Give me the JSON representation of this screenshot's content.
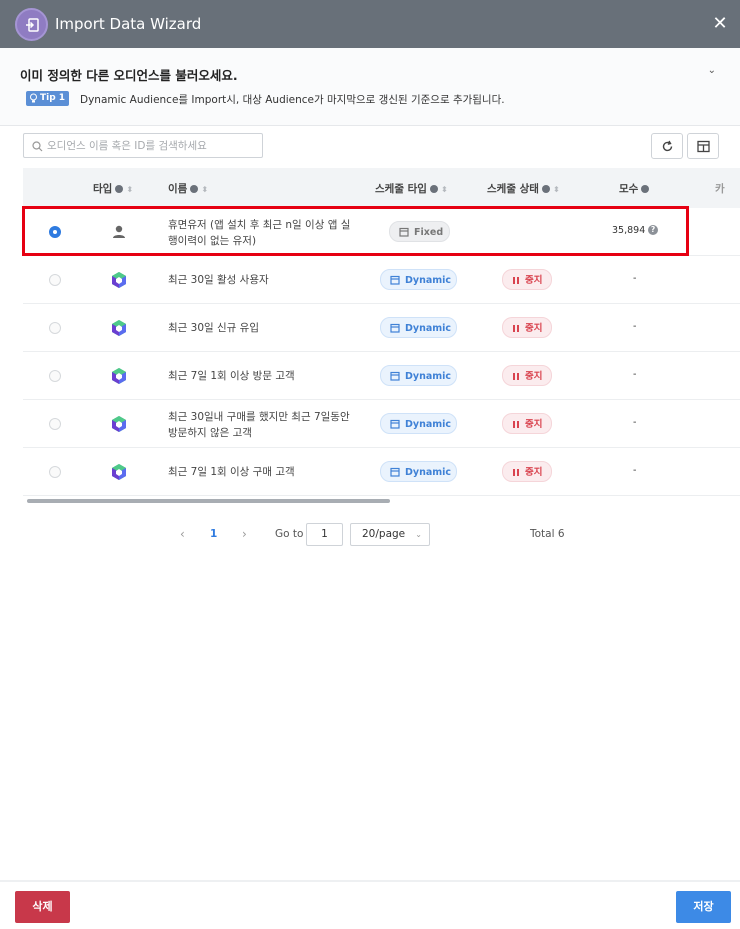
{
  "window": {
    "title": "Import Data Wizard",
    "close_label": "✕"
  },
  "header": {
    "heading": "이미 정의한 다른 오디언스를 불러오세요.",
    "tip_label": "Tip 1",
    "tip_text": "Dynamic Audience를 Import시, 대상 Audience가 마지막으로 갱신된 기준으로 추가됩니다."
  },
  "search": {
    "placeholder": "오디언스 이름 혹은 ID를 검색하세요",
    "value": ""
  },
  "columns": {
    "type": "타입",
    "name": "이름",
    "schedule_type": "스케줄 타입",
    "schedule_status": "스케줄 상태",
    "count": "모수",
    "cutoff": "카"
  },
  "rows": [
    {
      "selected": true,
      "type_icon": "person-icon",
      "name_line1": "휴면유저 (앱 설치 후 최근 n일 이상 앱 실",
      "name_line2": "행이력이 없는 유저)",
      "schedule_type": "Fixed",
      "schedule_status": "",
      "count": "35,894"
    },
    {
      "selected": false,
      "type_icon": "hexagon-cube-icon",
      "name_line1": "최근 30일 활성 사용자",
      "name_line2": "",
      "schedule_type": "Dynamic",
      "schedule_status": "중지",
      "count": "-"
    },
    {
      "selected": false,
      "type_icon": "hexagon-cube-icon",
      "name_line1": "최근 30일 신규 유입",
      "name_line2": "",
      "schedule_type": "Dynamic",
      "schedule_status": "중지",
      "count": "-"
    },
    {
      "selected": false,
      "type_icon": "hexagon-cube-icon",
      "name_line1": "최근 7일 1회 이상 방문 고객",
      "name_line2": "",
      "schedule_type": "Dynamic",
      "schedule_status": "중지",
      "count": "-"
    },
    {
      "selected": false,
      "type_icon": "hexagon-cube-icon",
      "name_line1": "최근 30일내 구매를 했지만 최근 7일동안",
      "name_line2": "방문하지 않은 고객",
      "schedule_type": "Dynamic",
      "schedule_status": "중지",
      "count": "-"
    },
    {
      "selected": false,
      "type_icon": "hexagon-cube-icon",
      "name_line1": "최근 7일 1회 이상 구매 고객",
      "name_line2": "",
      "schedule_type": "Dynamic",
      "schedule_status": "중지",
      "count": "-"
    }
  ],
  "pagination": {
    "prev": "‹",
    "current": "1",
    "next": "›",
    "goto_label": "Go to",
    "goto_value": "1",
    "page_size": "20/page",
    "total": "Total 6"
  },
  "footer": {
    "delete_label": "삭제",
    "save_label": "저장"
  },
  "colors": {
    "titlebar": "#687079",
    "highlight": "#e60012",
    "primary": "#3d8ae6",
    "danger": "#c8384a"
  }
}
